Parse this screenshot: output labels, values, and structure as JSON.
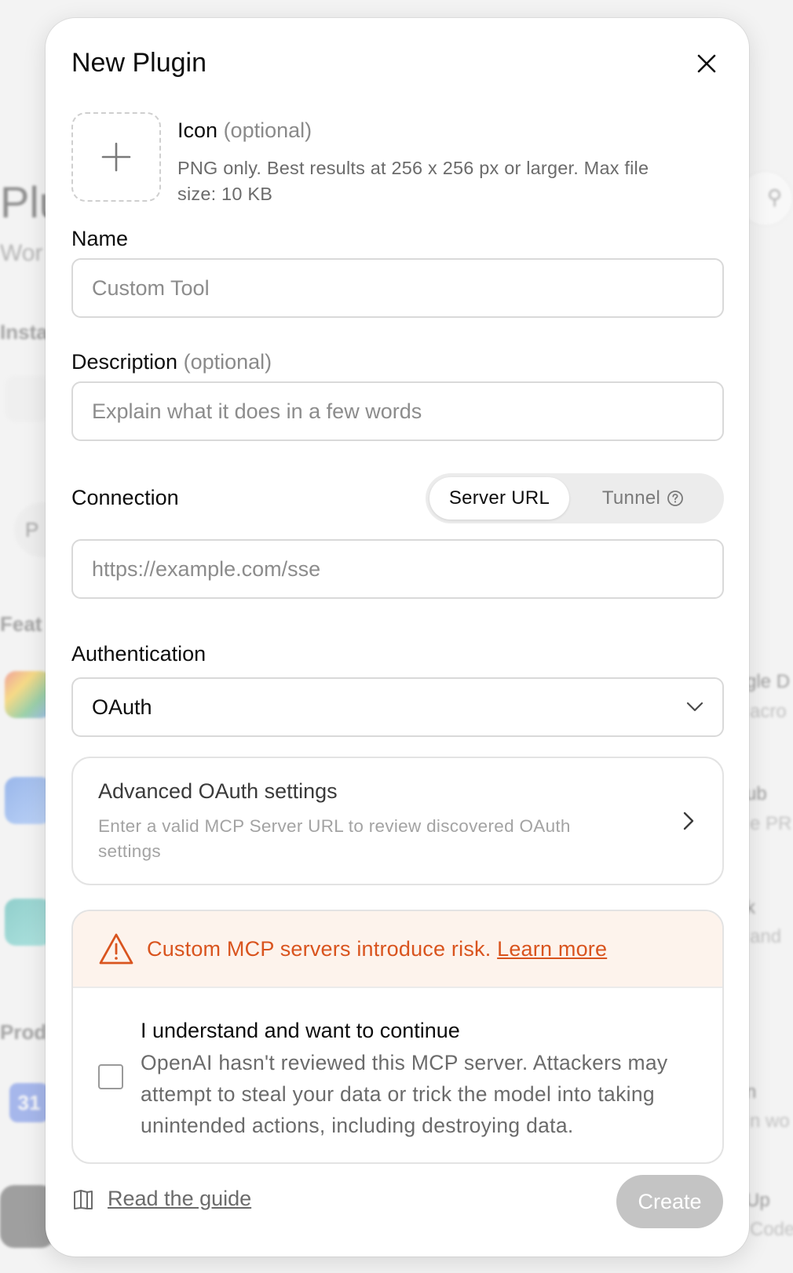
{
  "background": {
    "page_title": "Plu",
    "page_subtitle": "Wor",
    "section_installed": "Insta",
    "section_featured": "Feat",
    "section_productivity": "Prod",
    "pill_text": "P",
    "calendar_label": "31",
    "right_items": [
      {
        "title": "gle D",
        "sub": "acro"
      },
      {
        "title": "ub",
        "sub": "e PR"
      },
      {
        "title": "k",
        "sub": "and"
      },
      {
        "title": "n",
        "sub": "n wo"
      },
      {
        "title": "Up",
        "sub": "Code"
      }
    ]
  },
  "modal": {
    "title": "New Plugin",
    "icon_field": {
      "label": "Icon",
      "optional": "(optional)",
      "help": "PNG only. Best results at 256 x 256 px or larger. Max file size: 10 KB"
    },
    "name_field": {
      "label": "Name",
      "placeholder": "Custom Tool",
      "value": ""
    },
    "description_field": {
      "label": "Description",
      "optional": "(optional)",
      "placeholder": "Explain what it does in a few words",
      "value": ""
    },
    "connection": {
      "label": "Connection",
      "options": [
        "Server URL",
        "Tunnel"
      ],
      "selected": "Server URL",
      "url_placeholder": "https://example.com/sse",
      "url_value": ""
    },
    "authentication": {
      "label": "Authentication",
      "selected": "OAuth"
    },
    "advanced_oauth": {
      "title": "Advanced OAuth settings",
      "description": "Enter a valid MCP Server URL to review discovered OAuth settings"
    },
    "risk": {
      "warning_text": "Custom MCP servers introduce risk.",
      "learn_more": "Learn more",
      "confirm_title": "I understand and want to continue",
      "confirm_desc": "OpenAI hasn't reviewed this MCP server. Attackers may attempt to steal your data or trick the model into taking unintended actions, including destroying data.",
      "checked": false
    },
    "footer": {
      "guide_link": "Read the guide",
      "create_label": "Create"
    }
  },
  "colors": {
    "warning": "#d9541e",
    "warning_bg": "#fdf3ec",
    "disabled_button": "#c4c4c4"
  }
}
